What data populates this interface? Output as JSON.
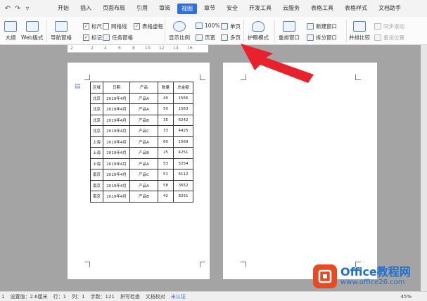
{
  "menubar": {
    "quick_icons": [
      "undo-icon",
      "redo-icon",
      "dropdown-icon"
    ],
    "tabs": [
      "开始",
      "插入",
      "页面布局",
      "引用",
      "审阅",
      "视图",
      "章节",
      "安全",
      "开发工具",
      "云服务",
      "表格工具",
      "表格样式",
      "文档助手"
    ],
    "active_tab": "视图"
  },
  "ribbon": {
    "outline": "大纲",
    "web_layout": "Web版式",
    "nav_pane": "导航窗格",
    "ruler": "标尺",
    "gridlines": "网格线",
    "table_gridlines": "表格虚框",
    "markup": "标记",
    "task_pane": "任务窗格",
    "show_scale": "显示比例",
    "zoom_100": "100%",
    "page_width": "页宽",
    "single_page": "单页",
    "multi_page": "多页",
    "eye_mode": "护眼模式",
    "rearrange": "重排窗口",
    "new_window": "新建窗口",
    "split_window": "拆分窗口",
    "side_by_side": "并排比较",
    "sync_scroll": "同步滚动",
    "reset_position": "重设位置"
  },
  "ruler_marks": [
    "2",
    "2",
    "4",
    "6",
    "8",
    "10",
    "12",
    "14",
    "16"
  ],
  "table": {
    "headers": [
      "区域",
      "日期",
      "产品",
      "数量",
      "总金额"
    ],
    "rows": [
      [
        "北京",
        "2019年4月",
        "产品A",
        "40",
        "1566"
      ],
      [
        "北京",
        "2019年4月",
        "产品A",
        "50",
        "1563"
      ],
      [
        "北京",
        "2019年4月",
        "产品B",
        "35",
        "6242"
      ],
      [
        "北京",
        "2019年4月",
        "产品C",
        "33",
        "4425"
      ],
      [
        "上海",
        "2019年4月",
        "产品A",
        "60",
        "1569"
      ],
      [
        "上海",
        "2019年4月",
        "产品B",
        "25",
        "4251"
      ],
      [
        "上海",
        "2019年4月",
        "产品A",
        "53",
        "5254"
      ],
      [
        "南京",
        "2019年4月",
        "产品C",
        "51",
        "6112"
      ],
      [
        "南京",
        "2019年4月",
        "产品A",
        "58",
        "3652"
      ],
      [
        "南京",
        "2019年4月",
        "产品B",
        "42",
        "8251"
      ]
    ]
  },
  "statusbar": {
    "page_num": "1",
    "setting": "设置值：2.6厘米",
    "row": "行：1",
    "col": "列：1",
    "words": "字数：121",
    "spell_check": "拼写检查",
    "doc_proof": "文档校对",
    "uncertified": "未认证",
    "zoom": "45%"
  },
  "watermark": {
    "title": "Office教程网",
    "url": "www.office26.com"
  },
  "colors": {
    "accent": "#2f6fde",
    "arrow": "#e8212c",
    "watermark_logo": "#e64b24",
    "watermark_text": "#1d6fd0"
  }
}
